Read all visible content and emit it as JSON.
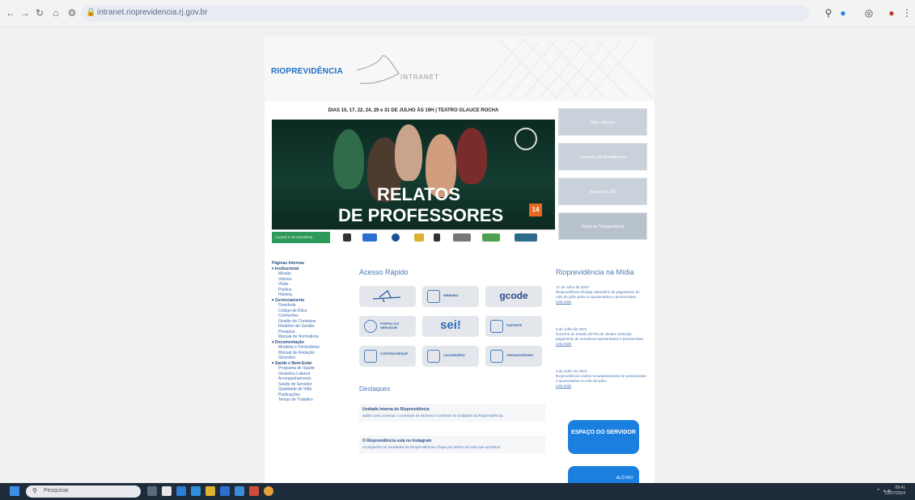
{
  "browser": {
    "url": "intranet.rioprevidencia.rj.gov.br"
  },
  "header": {
    "logo": "RIOPREVIDÊNCIA",
    "intranet": "INTRANET"
  },
  "banner": {
    "date_line": "DIAS 15, 17, 22, 24, 29 e 31 DE JULHO ÀS 19H | TEATRO GLAUCE ROCHA",
    "title_line1": "RELATOS",
    "title_line2": "DE PROFESSORES",
    "rating": "14",
    "sponsor_tag": "CLIQUE E SE INSCREVA"
  },
  "side_buttons": [
    "Veja o Banner",
    "Conselho de Atendimento",
    "Acesso ao SEI",
    "Portal da Transparência"
  ],
  "left_nav": [
    {
      "section": "Páginas Internas",
      "items": []
    },
    {
      "section": "Institucional",
      "items": [
        "Missão",
        "Valores",
        "Visão",
        "Política",
        "História"
      ]
    },
    {
      "section": "Gerenciamento",
      "items": [
        "Ouvidoria",
        "Código de Ética",
        "Comissões",
        "Gestão de Contratos",
        "Relatório de Gestão",
        "Pesquisa",
        "Manual de Normativos"
      ]
    },
    {
      "section": "Documentação",
      "items": [
        "Modelos e Formulários",
        "Manual de Redação",
        "Glossário"
      ]
    },
    {
      "section": "Saúde e Bem-Estar",
      "items": [
        "Programa de Saúde",
        "Ginástica Laboral",
        "Acompanhamento",
        "Saúde do Servidor",
        "Qualidade de Vida",
        "Publicações",
        "Tempo de Trabalho"
      ]
    }
  ],
  "acesso_rapido": {
    "title": "Acesso Rápido",
    "tiles": [
      {
        "label": "",
        "icon": "plane-icon"
      },
      {
        "label": "WEBMAIL",
        "icon": "monitor-icon"
      },
      {
        "label": "gcode",
        "icon": ""
      },
      {
        "label": "PORTAL DO SERVIDOR",
        "icon": "person-icon"
      },
      {
        "label": "sei!",
        "icon": ""
      },
      {
        "label": "SUPORTE",
        "icon": "headset-icon"
      },
      {
        "label": "CONTRACHEQUE",
        "icon": "doc-icon"
      },
      {
        "label": "CALENDÁRIO",
        "icon": "calendar-icon"
      },
      {
        "label": "ORGANOGRAMA",
        "icon": "org-icon"
      }
    ]
  },
  "destaques": {
    "title": "Destaques",
    "items": [
      {
        "title": "Unidade Interna do Rioprevidência",
        "desc": "Saiba como acessar o conteúdo da intranet e conhecer as unidades do Rioprevidência."
      },
      {
        "title": "O Rioprevidência está no Instagram",
        "desc": "Acompanhe as novidades do Rioprevidência e fique por dentro de tudo que acontece."
      }
    ]
  },
  "midia": {
    "title": "Rioprevidência na Mídia",
    "items": [
      {
        "date": "17 de Julho de 2024",
        "text": "Rioprevidência divulga calendário de pagamento do mês de julho para os aposentados e pensionistas.",
        "link": "Leia mais"
      },
      {
        "date": "5 de Julho de 2024",
        "text": "Governo do Estado do Rio de Janeiro antecipa pagamento de servidores aposentados e pensionistas.",
        "link": "Leia mais"
      },
      {
        "date": "3 de Julho de 2024",
        "text": "Rioprevidência realiza recadastramento de pensionistas e aposentados no mês de julho.",
        "link": "Leia mais"
      }
    ],
    "espaco_btn": "ESPAÇO DO SERVIDOR",
    "blue_btn": "ALÔ RIO"
  },
  "taskbar": {
    "search_placeholder": "Pesquisar",
    "time": "09:41",
    "date": "22/07/2024"
  },
  "colors": {
    "accent": "#1b7fe0",
    "link": "#4a78b3",
    "side_button": "#c9d1da"
  }
}
